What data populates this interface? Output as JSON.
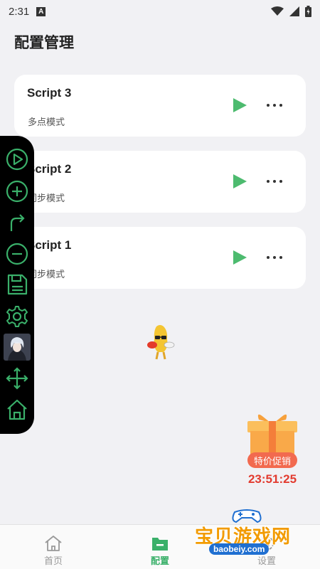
{
  "status_bar": {
    "time": "2:31",
    "notification_icon": "A"
  },
  "header": {
    "title": "配置管理"
  },
  "scripts": [
    {
      "name": "Script 3",
      "mode": "多点模式"
    },
    {
      "name": "Script 2",
      "mode": "同步模式"
    },
    {
      "name": "Script 1",
      "mode": "同步模式"
    }
  ],
  "toolbar": {
    "icons": [
      "play-circle-icon",
      "add-circle-icon",
      "redo-arrow-icon",
      "remove-circle-icon",
      "save-icon",
      "settings-icon",
      "avatar",
      "move-icon",
      "home-icon"
    ],
    "accent": "#3ab06a"
  },
  "promo": {
    "label": "特价促销",
    "timer": "23:51:25"
  },
  "bottom_nav": {
    "items": [
      {
        "label": "首页",
        "icon": "home-icon",
        "active": false
      },
      {
        "label": "配置",
        "icon": "folder-icon",
        "active": true
      },
      {
        "label": "设置",
        "icon": "settings-icon",
        "active": false
      }
    ]
  },
  "watermark": {
    "text": "宝贝游戏网",
    "url": "baobeiy.com"
  },
  "colors": {
    "accent_green": "#3ab06a",
    "play_green": "#4dbb6f",
    "timer_red": "#e23b2f",
    "background": "#f1f1f4"
  }
}
